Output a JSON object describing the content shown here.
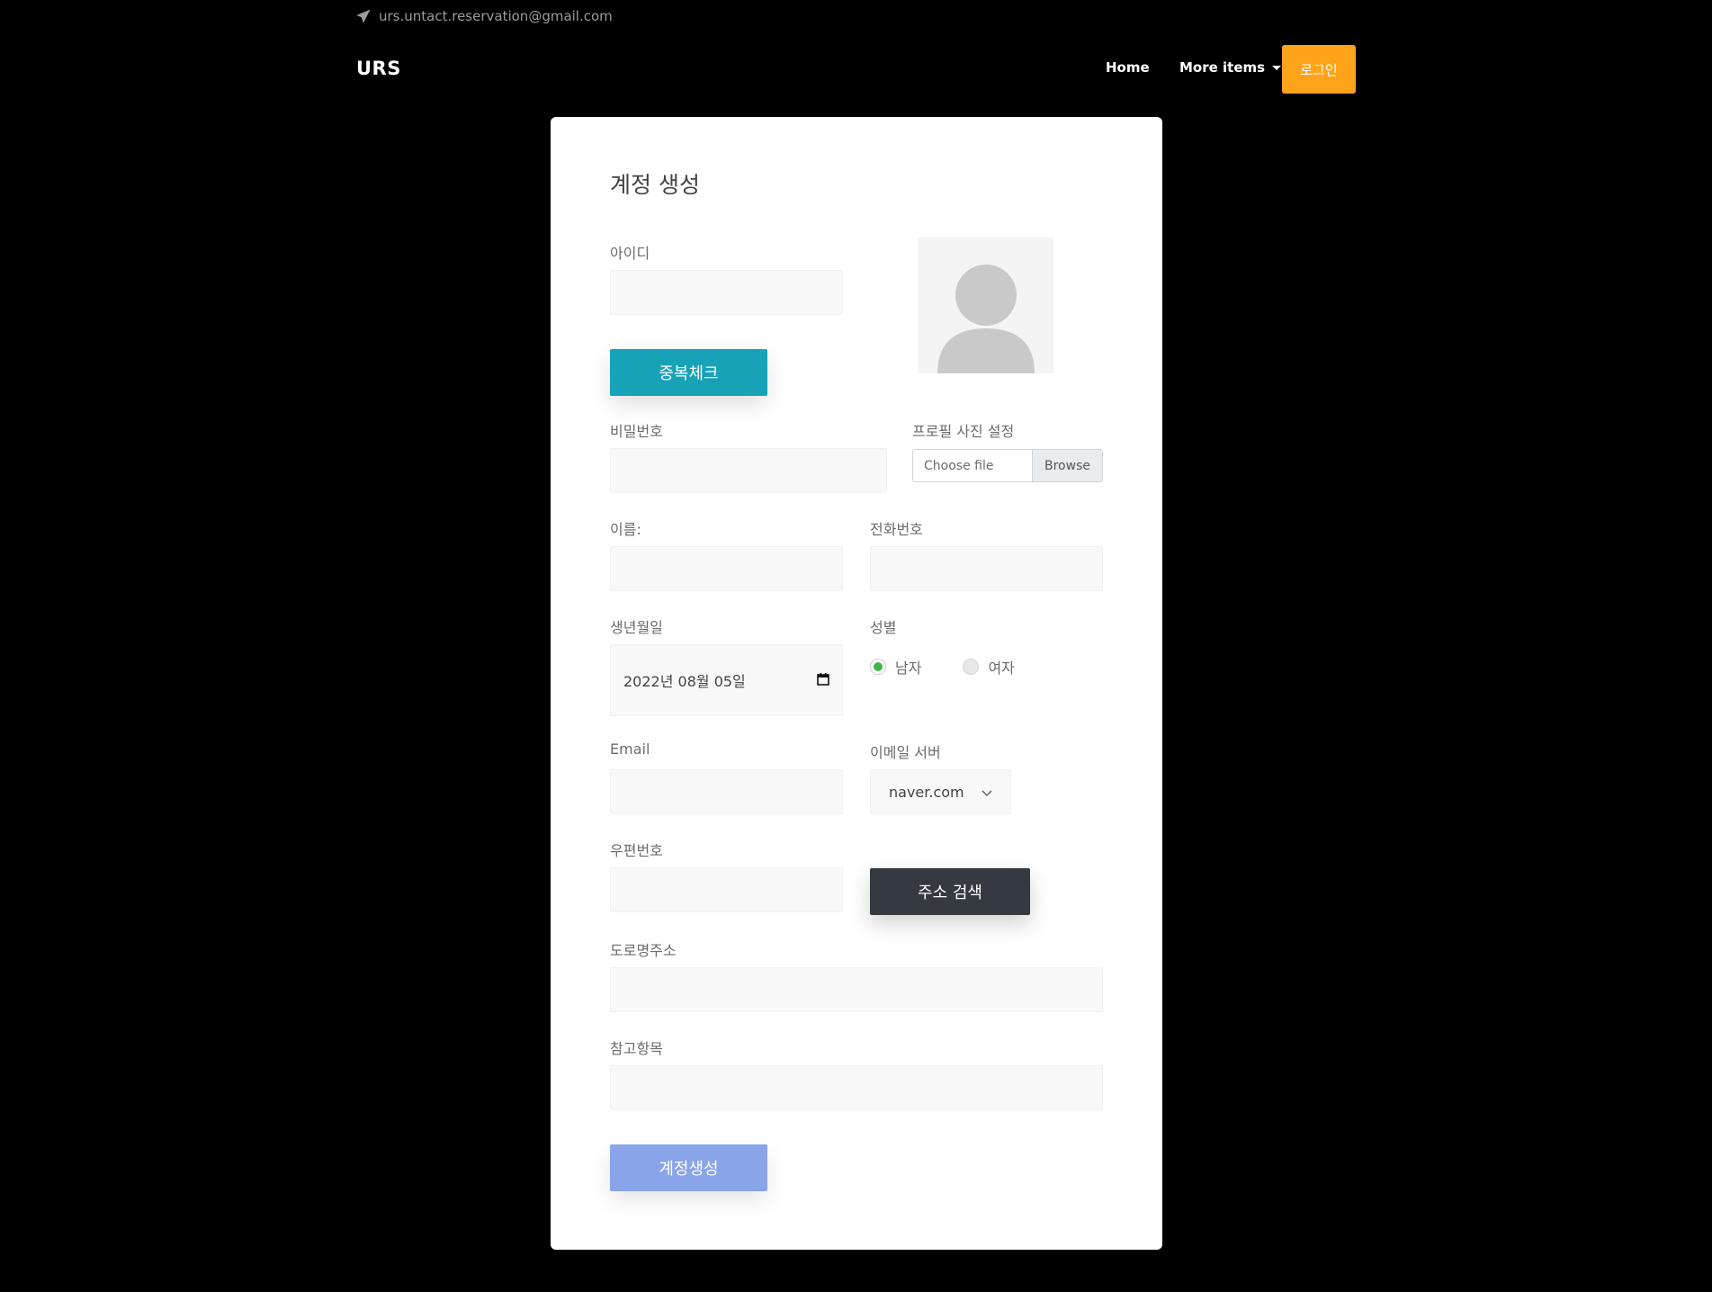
{
  "header": {
    "email": "urs.untact.reservation@gmail.com",
    "brand": "URS",
    "nav": {
      "home": "Home",
      "more": "More items",
      "login": "로그인"
    }
  },
  "form": {
    "title": "계정 생성",
    "id_label": "아이디",
    "dup_check": "중복체크",
    "password_label": "비밀번호",
    "profile_label": "프로필 사진 설정",
    "file_choose": "Choose file",
    "file_browse": "Browse",
    "name_label": "이름:",
    "phone_label": "전화번호",
    "birth_label": "생년월일",
    "birth_value": "2022년 08월 05일",
    "gender_label": "성별",
    "gender_options": [
      "남자",
      "여자"
    ],
    "gender_selected": "남자",
    "email_label": "Email",
    "email_server_label": "이메일 서버",
    "email_server_value": "naver.com",
    "zip_label": "우편번호",
    "address_search": "주소 검색",
    "road_address_label": "도로명주소",
    "reference_label": "참고항목",
    "submit": "계정생성"
  },
  "colors": {
    "background": "#000000",
    "login_button": "#ffa31a",
    "dup_check_button": "#17a2b8",
    "address_button": "#343a40",
    "submit_button": "#8aa4ea",
    "radio_checked": "#3fb54a"
  },
  "icons": {
    "top_bar": "paper-plane-icon",
    "avatar": "user-avatar-icon",
    "date": "calendar-icon",
    "select": "chevron-down-icon"
  }
}
